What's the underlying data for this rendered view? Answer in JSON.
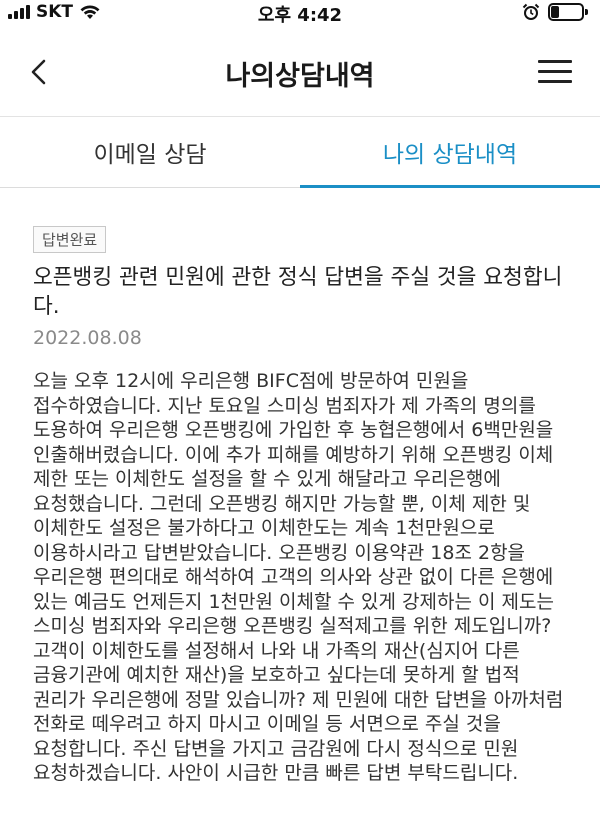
{
  "status_bar": {
    "carrier": "SKT",
    "time": "오후 4:42",
    "battery_level": 0.25
  },
  "nav": {
    "title": "나의상담내역"
  },
  "tabs": [
    {
      "label": "이메일 상담",
      "active": false
    },
    {
      "label": "나의 상담내역",
      "active": true
    }
  ],
  "post": {
    "badge": "답변완료",
    "title": "오픈뱅킹 관련 민원에 관한 정식 답변을 주실 것을 요청합니다.",
    "date": "2022.08.08",
    "body": "오늘 오후 12시에 우리은행 BIFC점에 방문하여 민원을 접수하였습니다. 지난 토요일 스미싱 범죄자가 제 가족의 명의를 도용하여 우리은행 오픈뱅킹에 가입한 후 농협은행에서 6백만원을 인출해버렸습니다. 이에 추가 피해를 예방하기 위해 오픈뱅킹 이체 제한 또는 이체한도 설정을 할 수 있게 해달라고 우리은행에 요청했습니다. 그런데 오픈뱅킹 해지만 가능할 뿐, 이체 제한 및 이체한도 설정은 불가하다고 이체한도는 계속 1천만원으로 이용하시라고 답변받았습니다. 오픈뱅킹 이용약관 18조 2항을 우리은행 편의대로 해석하여 고객의 의사와 상관 없이 다른 은행에 있는 예금도 언제든지 1천만원 이체할 수 있게 강제하는 이 제도는 스미싱 범죄자와 우리은행 오픈뱅킹 실적제고를 위한 제도입니까? 고객이 이체한도를 설정해서 나와 내 가족의 재산(심지어 다른 금융기관에 예치한 재산)을 보호하고 싶다는데 못하게 할 법적 권리가 우리은행에 정말 있습니까? 제 민원에 대한 답변을 아까처럼 전화로 떼우려고 하지 마시고 이메일 등 서면으로 주실 것을 요청합니다. 주신 답변을 가지고 금감원에 다시 정식으로 민원 요청하겠습니다. 사안이 시급한 만큼 빠른 답변 부탁드립니다."
  },
  "colors": {
    "accent": "#1b8fc6",
    "text": "#222222",
    "muted": "#8a8a8a"
  },
  "icons": {
    "back": "chevron-left-icon",
    "menu": "hamburger-menu-icon",
    "wifi": "wifi-icon",
    "alarm": "alarm-clock-icon",
    "battery": "battery-icon"
  }
}
